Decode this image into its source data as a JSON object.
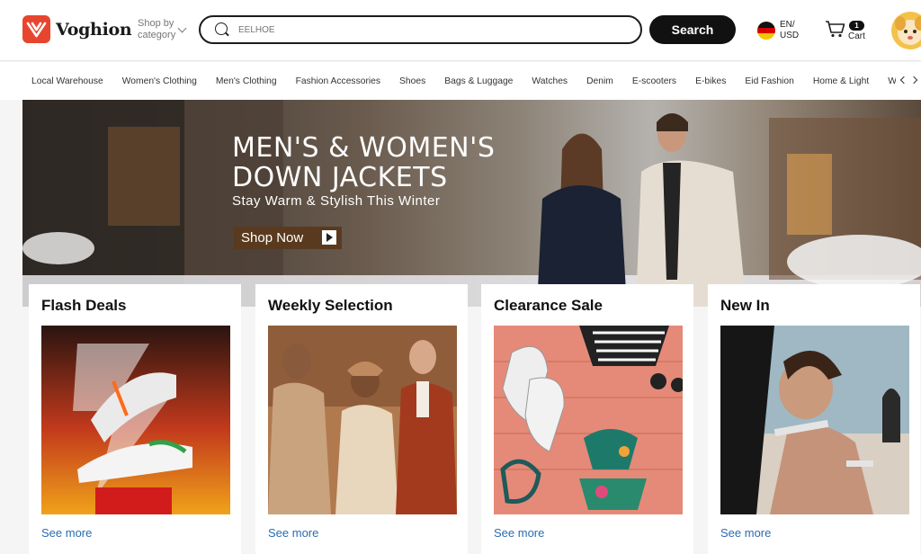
{
  "header": {
    "logo_text": "Voghion",
    "shop_by_line1": "Shop by",
    "shop_by_line2": "category",
    "search_placeholder": "EELHOE",
    "search_button": "Search",
    "lang_line1": "EN/",
    "lang_line2": "USD",
    "cart_count": "1",
    "cart_label": "Cart"
  },
  "nav": {
    "categories": [
      "Local Warehouse",
      "Women's Clothing",
      "Men's Clothing",
      "Fashion Accessories",
      "Shoes",
      "Bags & Luggage",
      "Watches",
      "Denim",
      "E-scooters",
      "E-bikes",
      "Eid Fashion",
      "Home & Light",
      "Workt"
    ]
  },
  "hero": {
    "title_line1": "MEN'S & WOMEN'S",
    "title_line2": "DOWN JACKETS",
    "subtitle": "Stay Warm & Stylish This Winter",
    "button": "Shop Now"
  },
  "cards": [
    {
      "title": "Flash Deals",
      "link": "See more"
    },
    {
      "title": "Weekly Selection",
      "link": "See more"
    },
    {
      "title": "Clearance Sale",
      "link": "See more"
    },
    {
      "title": "New In",
      "link": "See more"
    }
  ],
  "colors": {
    "brand": "#e8452f",
    "link": "#2b6cb0",
    "button_dark": "#111111",
    "hero_button": "#5a3a1f"
  }
}
